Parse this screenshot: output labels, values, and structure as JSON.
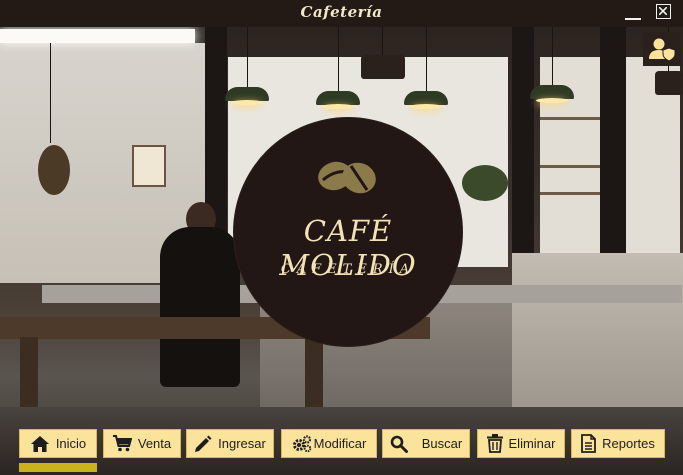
{
  "window": {
    "title": "Cafetería"
  },
  "logo": {
    "title": "CAFÉ MOLIDO",
    "subtitle": "CAFETERÍA"
  },
  "toolbar": {
    "buttons": [
      {
        "label": "Inicio",
        "icon": "home-icon"
      },
      {
        "label": "Venta",
        "icon": "cart-icon"
      },
      {
        "label": "Ingresar",
        "icon": "pencil-icon"
      },
      {
        "label": "Modificar",
        "icon": "gears-icon"
      },
      {
        "label": "Buscar",
        "icon": "search-icon"
      },
      {
        "label": "Eliminar",
        "icon": "trash-icon"
      },
      {
        "label": "Reportes",
        "icon": "report-icon"
      }
    ],
    "active_index": 0
  },
  "colors": {
    "titlebar": "#231915",
    "button": "#fbe39c",
    "active_indicator": "#c9b21c",
    "logo_bg": "#221715",
    "logo_text": "#f1e3b4"
  },
  "background_image": "cafe-interior-photo"
}
